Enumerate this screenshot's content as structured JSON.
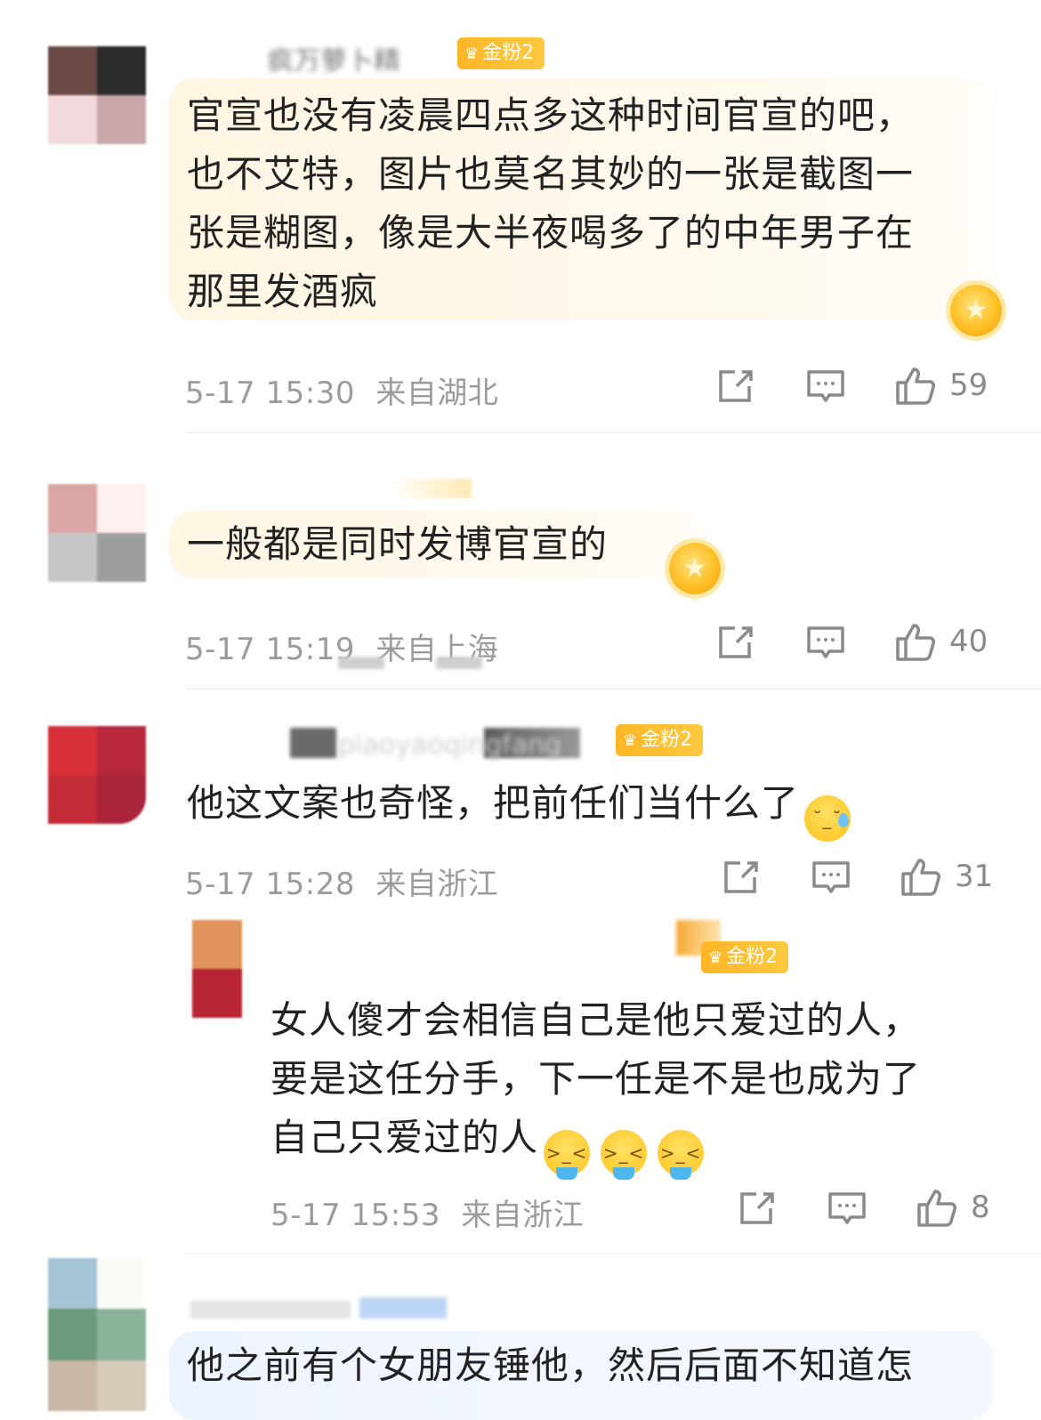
{
  "comments": [
    {
      "username": "疯万萝卜精",
      "badge": "金粉2",
      "text_lines": [
        "官宣也没有凌晨四点多这种时间官宣的吧，",
        "也不艾特，图片也莫名其妙的一张是截图一",
        "张是糊图，像是大半夜喝多了的中年男子在",
        "那里发酒疯"
      ],
      "time": "5-17 15:30",
      "location": "来自湖北",
      "likes": "59",
      "avatar_colors": [
        "#6b4a46",
        "#2b2b2b",
        "#f3d9dc",
        "#c9a6aa"
      ]
    },
    {
      "username": "",
      "badge": "",
      "text_lines": [
        "一般都是同时发博官宣的"
      ],
      "time": "5-17 15:19",
      "location": "来自上海",
      "likes": "40",
      "avatar_colors": [
        "#d9a6a4",
        "#fdf0ef",
        "#c6c6c8",
        "#9e9e9e"
      ]
    },
    {
      "username": "piaoyaoqingfang",
      "badge": "金粉2",
      "text_lines": [
        "他这文案也奇怪，把前任们当什么了"
      ],
      "time": "5-17 15:28",
      "location": "来自浙江",
      "likes": "31",
      "avatar_colors": [
        "#d7303b",
        "#b7283a",
        "#c22b35",
        "#a9243a"
      ]
    },
    {
      "username": "",
      "badge": "金粉2",
      "text_lines": [
        "女人傻才会相信自己是他只爱过的人，",
        "要是这任分手，下一任是不是也成为了",
        "自己只爱过的人"
      ],
      "time": "5-17 15:53",
      "location": "来自浙江",
      "likes": "8",
      "avatar_colors": [
        "#e0935a",
        "#b72434"
      ]
    },
    {
      "username": "",
      "badge": "",
      "text_lines": [
        "他之前有个女朋友锤他，然后后面不知道怎"
      ],
      "avatar_colors": [
        "#a6c3d6",
        "#fbfbf5",
        "#6b9b7a",
        "#8ab39a",
        "#c9b8a6",
        "#d6cab8"
      ]
    }
  ],
  "icons": {
    "share": "share-icon",
    "comment": "comment-icon",
    "like": "thumbs-up-icon",
    "medal": "fan-medal-icon"
  },
  "colors": {
    "badge": "#ffbf2e",
    "bubble": "#fff6e3",
    "meta_text": "#9b9b9b"
  }
}
